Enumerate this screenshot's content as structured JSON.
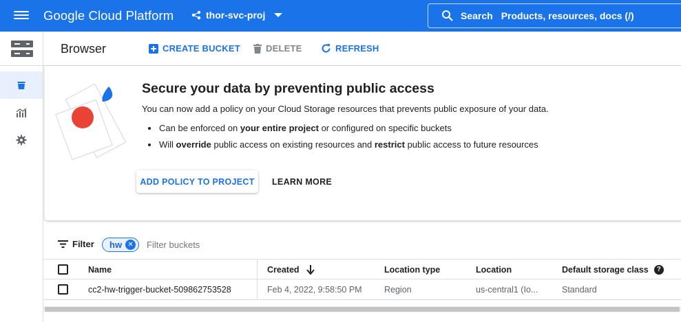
{
  "topbar": {
    "brand": "Google Cloud Platform",
    "project_name": "thor-svc-proj",
    "search_label": "Search",
    "search_placeholder": "Products, resources, docs (/)"
  },
  "toolbar": {
    "title": "Browser",
    "create_label": "CREATE BUCKET",
    "delete_label": "DELETE",
    "refresh_label": "REFRESH"
  },
  "banner": {
    "title": "Secure your data by preventing public access",
    "description": "You can now add a policy on your Cloud Storage resources that prevents public exposure of your data.",
    "bullet1_pre": "Can be enforced on ",
    "bullet1_bold": "your entire project",
    "bullet1_post": " or configured on specific buckets",
    "bullet2_pre": "Will ",
    "bullet2_bold1": "override",
    "bullet2_mid": " public access on existing resources and ",
    "bullet2_bold2": "restrict",
    "bullet2_post": " public access to future resources",
    "primary_button": "ADD POLICY TO PROJECT",
    "secondary_button": "LEARN MORE"
  },
  "filter": {
    "label": "Filter",
    "chip_value": "hw",
    "placeholder": "Filter buckets"
  },
  "table": {
    "headers": {
      "name": "Name",
      "created": "Created",
      "location_type": "Location type",
      "location": "Location",
      "storage_class": "Default storage class"
    },
    "rows": [
      {
        "name": "cc2-hw-trigger-bucket-509862753528",
        "created": "Feb 4, 2022, 9:58:50 PM",
        "location_type": "Region",
        "location": "us-central1 (Io...",
        "storage_class": "Standard"
      }
    ]
  },
  "colors": {
    "brand_blue": "#1a73e8",
    "accent_red": "#ea4335",
    "nav_active_bg": "#e8f0fe"
  }
}
